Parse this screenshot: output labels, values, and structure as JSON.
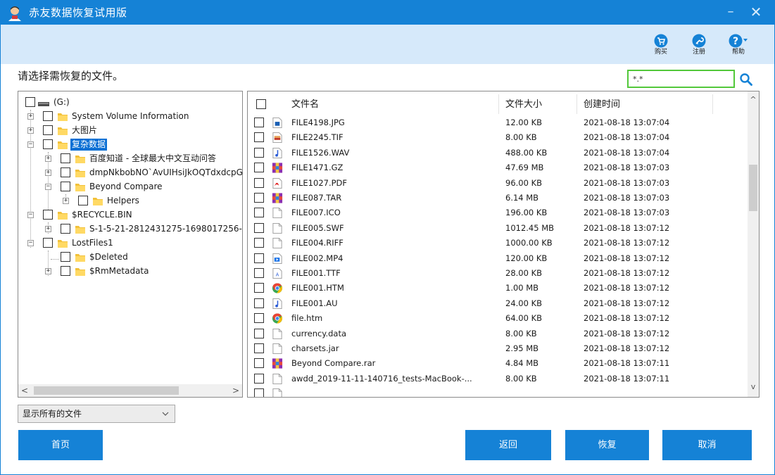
{
  "window": {
    "title": "赤友数据恢复试用版",
    "minimize_glyph": "–",
    "close_glyph": "✕"
  },
  "toolbar": {
    "buy_label": "购买",
    "register_label": "注册",
    "help_label": "帮助"
  },
  "prompt": "请选择需恢复的文件。",
  "search": {
    "value": "*.*"
  },
  "tree": {
    "nodes": [
      {
        "label": "(G:)",
        "kind": "drive"
      },
      {
        "label": "System Volume Information",
        "kind": "folder"
      },
      {
        "label": "大图片",
        "kind": "folder"
      },
      {
        "label": "复杂数据",
        "kind": "folder",
        "selected": true
      },
      {
        "label": "百度知道 - 全球最大中文互动问答",
        "kind": "folder"
      },
      {
        "label": "dmpNkbobNO`AvUIHsiJkOQTdxdcpGL",
        "kind": "folder"
      },
      {
        "label": "Beyond Compare",
        "kind": "folder"
      },
      {
        "label": "Helpers",
        "kind": "folder"
      },
      {
        "label": "$RECYCLE.BIN",
        "kind": "folder"
      },
      {
        "label": "S-1-5-21-2812431275-1698017256-",
        "kind": "folder"
      },
      {
        "label": "LostFiles1",
        "kind": "folder"
      },
      {
        "label": "$Deleted",
        "kind": "folder"
      },
      {
        "label": "$RmMetadata",
        "kind": "folder"
      }
    ],
    "scroll_left": "<",
    "scroll_right": ">"
  },
  "file_list": {
    "headers": {
      "name": "文件名",
      "size": "文件大小",
      "date": "创建时间"
    },
    "rows": [
      {
        "name": "FILE4198.JPG",
        "size": "12.00 KB",
        "date": "2021-08-18 13:07:04",
        "icon": "image-file-icon"
      },
      {
        "name": "FILE2245.TIF",
        "size": "8.00 KB",
        "date": "2021-08-18 13:07:04",
        "icon": "tif-file-icon"
      },
      {
        "name": "FILE1526.WAV",
        "size": "488.00 KB",
        "date": "2021-08-18 13:07:04",
        "icon": "audio-file-icon"
      },
      {
        "name": "FILE1471.GZ",
        "size": "47.69 MB",
        "date": "2021-08-18 13:07:03",
        "icon": "archive-file-icon"
      },
      {
        "name": "FILE1027.PDF",
        "size": "96.00 KB",
        "date": "2021-08-18 13:07:03",
        "icon": "pdf-file-icon"
      },
      {
        "name": "FILE087.TAR",
        "size": "6.14 MB",
        "date": "2021-08-18 13:07:03",
        "icon": "archive-file-icon"
      },
      {
        "name": "FILE007.ICO",
        "size": "196.00 KB",
        "date": "2021-08-18 13:07:03",
        "icon": "blank-file-icon"
      },
      {
        "name": "FILE005.SWF",
        "size": "1012.45 MB",
        "date": "2021-08-18 13:07:12",
        "icon": "blank-file-icon"
      },
      {
        "name": "FILE004.RIFF",
        "size": "1000.00 KB",
        "date": "2021-08-18 13:07:12",
        "icon": "blank-file-icon"
      },
      {
        "name": "FILE002.MP4",
        "size": "120.00 KB",
        "date": "2021-08-18 13:07:12",
        "icon": "video-file-icon"
      },
      {
        "name": "FILE001.TTF",
        "size": "28.00 KB",
        "date": "2021-08-18 13:07:12",
        "icon": "font-file-icon"
      },
      {
        "name": "FILE001.HTM",
        "size": "1.00 MB",
        "date": "2021-08-18 13:07:12",
        "icon": "chrome-html-icon"
      },
      {
        "name": "FILE001.AU",
        "size": "24.00 KB",
        "date": "2021-08-18 13:07:12",
        "icon": "audio-file-icon"
      },
      {
        "name": "file.htm",
        "size": "64.00 KB",
        "date": "2021-08-18 13:07:12",
        "icon": "chrome-html-icon"
      },
      {
        "name": "currency.data",
        "size": "8.00 KB",
        "date": "2021-08-18 13:07:12",
        "icon": "blank-file-icon"
      },
      {
        "name": "charsets.jar",
        "size": "2.95 MB",
        "date": "2021-08-18 13:07:12",
        "icon": "blank-file-icon"
      },
      {
        "name": "Beyond Compare.rar",
        "size": "4.84 MB",
        "date": "2021-08-18 13:07:11",
        "icon": "archive-file-icon"
      },
      {
        "name": "awdd_2019-11-11-140716_tests-MacBook-...",
        "size": "8.00 KB",
        "date": "2021-08-18 13:07:11",
        "icon": "blank-file-icon"
      }
    ]
  },
  "filter": {
    "value": "显示所有的文件"
  },
  "buttons": {
    "home": "首页",
    "back": "返回",
    "recover": "恢复",
    "cancel": "取消"
  },
  "colors": {
    "accent": "#1582d6",
    "toolbar_bg": "#d6e9fa",
    "selection": "#0a6fd4",
    "search_border": "#52c83a"
  }
}
